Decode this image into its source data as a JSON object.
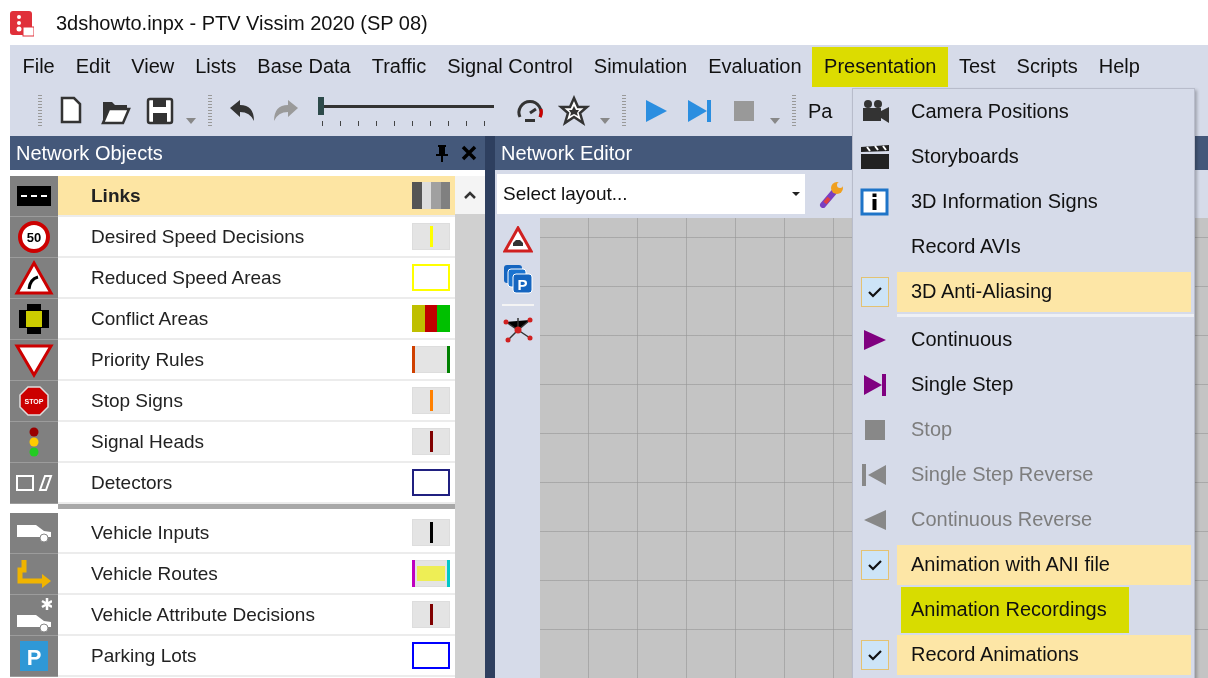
{
  "window": {
    "title": "3dshowto.inpx - PTV Vissim 2020 (SP 08)"
  },
  "menu_bar": [
    {
      "label": "File",
      "selected": false
    },
    {
      "label": "Edit",
      "selected": false
    },
    {
      "label": "View",
      "selected": false
    },
    {
      "label": "Lists",
      "selected": false
    },
    {
      "label": "Base Data",
      "selected": false
    },
    {
      "label": "Traffic",
      "selected": false
    },
    {
      "label": "Signal Control",
      "selected": false
    },
    {
      "label": "Simulation",
      "selected": false
    },
    {
      "label": "Evaluation",
      "selected": false
    },
    {
      "label": "Presentation",
      "selected": true
    },
    {
      "label": "Test",
      "selected": false
    },
    {
      "label": "Scripts",
      "selected": false
    },
    {
      "label": "Help",
      "selected": false
    }
  ],
  "toolbar": {
    "items": [
      {
        "kind": "grip"
      },
      {
        "kind": "new",
        "disabled": false
      },
      {
        "kind": "open",
        "disabled": false
      },
      {
        "kind": "save",
        "disabled": false
      },
      {
        "kind": "caret"
      },
      {
        "kind": "grip"
      },
      {
        "kind": "undo",
        "disabled": false
      },
      {
        "kind": "redo",
        "disabled": true
      },
      {
        "kind": "slider",
        "level": 0
      },
      {
        "kind": "speed",
        "disabled": false
      },
      {
        "kind": "star",
        "disabled": false
      },
      {
        "kind": "caret"
      },
      {
        "kind": "grip"
      },
      {
        "kind": "play",
        "disabled": false
      },
      {
        "kind": "step",
        "disabled": false
      },
      {
        "kind": "stop",
        "disabled": true
      },
      {
        "kind": "caret"
      },
      {
        "kind": "grip"
      },
      {
        "kind": "text",
        "label": "Pa"
      }
    ]
  },
  "network_objects": {
    "title": "Network Objects",
    "groups": [
      [
        {
          "label": "Links",
          "kind": "link",
          "selected": true,
          "swatch": {
            "kind": "stripes",
            "parts": [
              {
                "color": "#555555"
              },
              {
                "color": "#dddddd"
              },
              {
                "color": "#a0a0a0"
              },
              {
                "color": "#808080"
              }
            ]
          }
        },
        {
          "label": "Desired Speed Decisions",
          "kind": "speed",
          "sign_text": "50",
          "selected": false,
          "swatch": {
            "kind": "line",
            "parts": [
              {
                "color": "#ffff00"
              }
            ]
          }
        },
        {
          "label": "Reduced Speed Areas",
          "kind": "curve",
          "selected": false,
          "swatch": {
            "kind": "outline",
            "parts": [
              {
                "color": "#ffff00"
              }
            ]
          }
        },
        {
          "label": "Conflict Areas",
          "kind": "conflict",
          "selected": false,
          "swatch": {
            "kind": "stripes",
            "parts": [
              {
                "color": "#bfbf00"
              },
              {
                "color": "#c00000"
              },
              {
                "color": "#00c000"
              }
            ]
          }
        },
        {
          "label": "Priority Rules",
          "kind": "yield",
          "selected": false,
          "swatch": {
            "kind": "edges",
            "parts": [
              {
                "color": "#d04000"
              },
              {
                "color": "#008000"
              }
            ]
          }
        },
        {
          "label": "Stop Signs",
          "kind": "stop",
          "sign_text": "STOP",
          "selected": false,
          "swatch": {
            "kind": "line",
            "parts": [
              {
                "color": "#ff8000"
              }
            ]
          }
        },
        {
          "label": "Signal Heads",
          "kind": "signal",
          "selected": false,
          "swatch": {
            "kind": "line",
            "parts": [
              {
                "color": "#800000"
              }
            ]
          }
        },
        {
          "label": "Detectors",
          "kind": "detector",
          "selected": false,
          "swatch": {
            "kind": "outline",
            "parts": [
              {
                "color": "#202080"
              }
            ]
          }
        }
      ],
      [
        {
          "label": "Vehicle Inputs",
          "kind": "car",
          "selected": false,
          "swatch": {
            "kind": "line",
            "parts": [
              {
                "color": "#000000"
              }
            ]
          }
        },
        {
          "label": "Vehicle Routes",
          "kind": "route",
          "selected": false,
          "swatch": {
            "kind": "route",
            "parts": [
              {
                "color": "#c000c0"
              },
              {
                "color": "#eeee55"
              },
              {
                "color": "#00c8c8"
              }
            ]
          }
        },
        {
          "label": "Vehicle Attribute Decisions",
          "kind": "car-star",
          "selected": false,
          "swatch": {
            "kind": "line",
            "parts": [
              {
                "color": "#800000"
              }
            ]
          }
        },
        {
          "label": "Parking Lots",
          "kind": "parking",
          "sign_text": "P",
          "selected": false,
          "swatch": {
            "kind": "outline",
            "parts": [
              {
                "color": "#0000ff"
              }
            ]
          }
        }
      ]
    ]
  },
  "network_editor": {
    "title": "Network Editor",
    "layout_select": {
      "value": "Select layout..."
    },
    "tools": [
      {
        "kind": "warning"
      },
      {
        "kind": "parking",
        "sign_text": "P"
      },
      {
        "kind": "nodes"
      }
    ]
  },
  "presentation_menu": {
    "groups": [
      [
        {
          "label": "Camera Positions",
          "kind": "camera",
          "checked": false,
          "disabled": false,
          "highlighted": false
        },
        {
          "label": "Storyboards",
          "kind": "clapper",
          "checked": false,
          "disabled": false,
          "highlighted": false
        },
        {
          "label": "3D Information Signs",
          "kind": "info",
          "checked": false,
          "disabled": false,
          "highlighted": false
        },
        {
          "label": "Record AVIs",
          "kind": "plain",
          "checked": false,
          "disabled": false,
          "highlighted": false
        },
        {
          "label": "3D Anti-Aliasing",
          "checked": true,
          "disabled": false,
          "highlighted": false
        }
      ],
      [
        {
          "label": "Continuous",
          "kind": "play",
          "checked": false,
          "disabled": false,
          "highlighted": false
        },
        {
          "label": "Single Step",
          "kind": "step",
          "checked": false,
          "disabled": false,
          "highlighted": false
        },
        {
          "label": "Stop",
          "kind": "stop",
          "checked": false,
          "disabled": true,
          "highlighted": false
        },
        {
          "label": "Single Step Reverse",
          "kind": "step-back",
          "checked": false,
          "disabled": true,
          "highlighted": false
        },
        {
          "label": "Continuous Reverse",
          "kind": "reverse",
          "checked": false,
          "disabled": true,
          "highlighted": false
        },
        {
          "label": "Animation with ANI file",
          "checked": true,
          "disabled": false,
          "highlighted": false
        },
        {
          "label": "Animation Recordings",
          "kind": "plain",
          "checked": false,
          "disabled": false,
          "highlighted": true
        },
        {
          "label": "Record Animations",
          "checked": true,
          "disabled": false,
          "highlighted": false
        }
      ]
    ]
  }
}
